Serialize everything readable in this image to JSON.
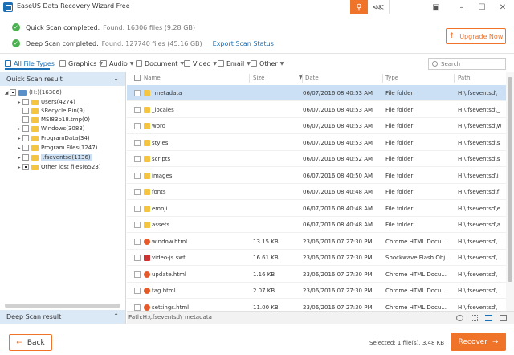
{
  "window": {
    "title": "EaseUS Data Recovery Wizard Free",
    "accent": "#f0732a",
    "brand": "#1b6fb5"
  },
  "summary": {
    "quick_label": "Quick Scan completed.",
    "quick_detail": "Found: 16306 files (9.28 GB)",
    "deep_label": "Deep Scan completed.",
    "deep_detail": "Found: 127740 files (45.16 GB)",
    "export_label": "Export Scan Status",
    "upgrade_label": "Upgrade Now"
  },
  "filters": {
    "tabs": [
      "All File Types",
      "Graphics",
      "Audio",
      "Document",
      "Video",
      "Email",
      "Other"
    ],
    "search_placeholder": "Search"
  },
  "left_panel": {
    "quick_header": "Quick Scan result",
    "deep_header": "Deep Scan result",
    "tree": [
      {
        "label": "(H:)(16306)",
        "icon": "drive-icon"
      },
      {
        "label": "Users(4274)",
        "icon": "folder-icon"
      },
      {
        "label": "$Recycle.Bin(9)",
        "icon": "folder-icon"
      },
      {
        "label": "MSI83b18.tmp(0)",
        "icon": "folder-icon"
      },
      {
        "label": "Windows(3083)",
        "icon": "folder-icon"
      },
      {
        "label": "ProgramData(34)",
        "icon": "folder-icon"
      },
      {
        "label": "Program Files(1247)",
        "icon": "folder-icon"
      },
      {
        "label": ".fseventsd(1136)",
        "icon": "folder-icon"
      },
      {
        "label": "Other lost files(6523)",
        "icon": "folder-icon"
      }
    ]
  },
  "file_list": {
    "columns": [
      "Name",
      "Size",
      "Date",
      "Type",
      "Path"
    ],
    "rows": [
      {
        "name": "_metadata",
        "size": "",
        "date": "06/07/2016 08:40:53 AM",
        "type": "File folder",
        "path": "H:\\.fseventsd\\_",
        "icon": "folder-icon"
      },
      {
        "name": "_locales",
        "size": "",
        "date": "06/07/2016 08:40:53 AM",
        "type": "File folder",
        "path": "H:\\.fseventsd\\_",
        "icon": "folder-icon"
      },
      {
        "name": "word",
        "size": "",
        "date": "06/07/2016 08:40:53 AM",
        "type": "File folder",
        "path": "H:\\.fseventsd\\w",
        "icon": "folder-icon"
      },
      {
        "name": "styles",
        "size": "",
        "date": "06/07/2016 08:40:53 AM",
        "type": "File folder",
        "path": "H:\\.fseventsd\\s",
        "icon": "folder-icon"
      },
      {
        "name": "scripts",
        "size": "",
        "date": "06/07/2016 08:40:52 AM",
        "type": "File folder",
        "path": "H:\\.fseventsd\\s",
        "icon": "folder-icon"
      },
      {
        "name": "images",
        "size": "",
        "date": "06/07/2016 08:40:50 AM",
        "type": "File folder",
        "path": "H:\\.fseventsd\\i",
        "icon": "folder-icon"
      },
      {
        "name": "fonts",
        "size": "",
        "date": "06/07/2016 08:40:48 AM",
        "type": "File folder",
        "path": "H:\\.fseventsd\\f",
        "icon": "folder-icon"
      },
      {
        "name": "emoji",
        "size": "",
        "date": "06/07/2016 08:40:48 AM",
        "type": "File folder",
        "path": "H:\\.fseventsd\\e",
        "icon": "folder-icon"
      },
      {
        "name": "assets",
        "size": "",
        "date": "06/07/2016 08:40:48 AM",
        "type": "File folder",
        "path": "H:\\.fseventsd\\a",
        "icon": "folder-icon"
      },
      {
        "name": "window.html",
        "size": "13.15 KB",
        "date": "23/06/2016 07:27:30 PM",
        "type": "Chrome HTML Docu...",
        "path": "H:\\.fseventsd\\",
        "icon": "html-file-icon"
      },
      {
        "name": "video-js.swf",
        "size": "16.61 KB",
        "date": "23/06/2016 07:27:30 PM",
        "type": "Shockwave Flash Obj...",
        "path": "H:\\.fseventsd\\",
        "icon": "swf-file-icon"
      },
      {
        "name": "update.html",
        "size": "1.16 KB",
        "date": "23/06/2016 07:27:30 PM",
        "type": "Chrome HTML Docu...",
        "path": "H:\\.fseventsd\\",
        "icon": "html-file-icon"
      },
      {
        "name": "tag.html",
        "size": "2.07 KB",
        "date": "23/06/2016 07:27:30 PM",
        "type": "Chrome HTML Docu...",
        "path": "H:\\.fseventsd\\",
        "icon": "html-file-icon"
      },
      {
        "name": "settings.html",
        "size": "11.00 KB",
        "date": "23/06/2016 07:27:30 PM",
        "type": "Chrome HTML Docu...",
        "path": "H:\\.fseventsd\\",
        "icon": "html-file-icon"
      }
    ]
  },
  "path_bar": {
    "path": "Path:H:\\.fseventsd\\_metadata"
  },
  "bottom": {
    "back_label": "Back",
    "selected_info": "Selected: 1 file(s), 3.48 KB",
    "recover_label": "Recover"
  }
}
